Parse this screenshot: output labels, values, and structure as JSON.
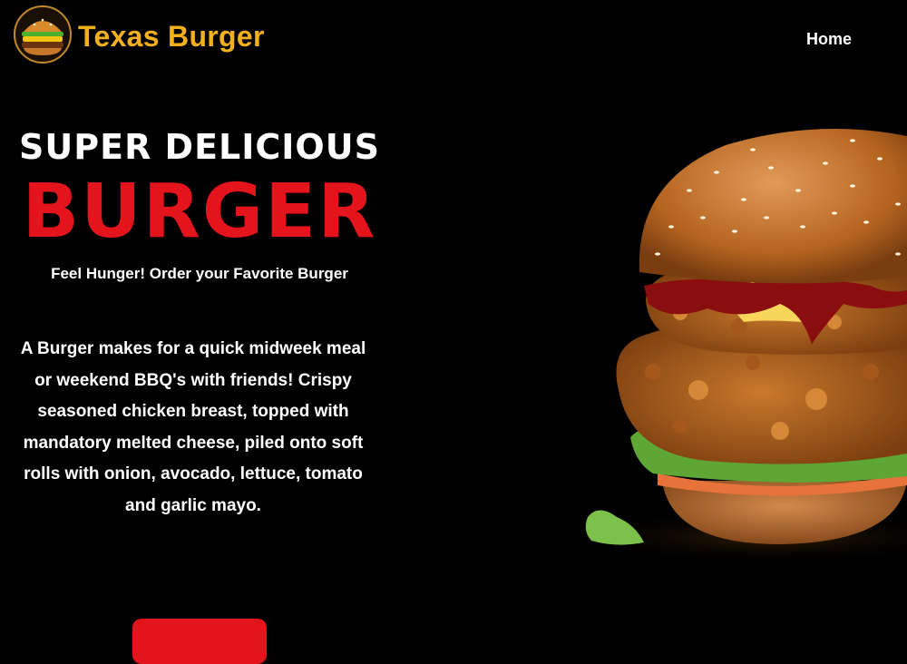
{
  "header": {
    "brand": "Texas Burger",
    "nav": {
      "home": "Home"
    }
  },
  "hero": {
    "headline_top": "SUPER DELICIOUS",
    "headline_main": "BURGER",
    "tagline": "Feel Hunger! Order your Favorite Burger",
    "description": "A Burger makes for a quick midweek meal or weekend BBQ's with friends! Crispy seasoned chicken breast, topped with mandatory melted cheese, piled onto soft rolls with onion, avocado, lettuce, tomato and garlic mayo.",
    "button_label": ""
  },
  "colors": {
    "background": "#000000",
    "brand": "#f2b01e",
    "accent": "#e4141c",
    "text": "#ffffff"
  },
  "icons": {
    "logo": "burger-logo-icon",
    "hero_image": "fried-chicken-burger-image"
  }
}
